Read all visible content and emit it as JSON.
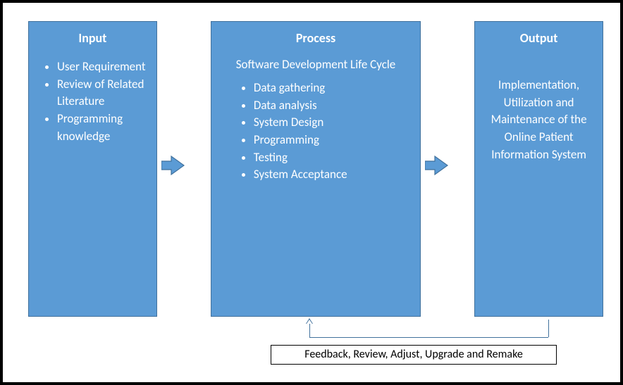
{
  "input": {
    "title": "Input",
    "items": [
      "User Requirement",
      "Review of Related Literature",
      "Programming knowledge"
    ]
  },
  "process": {
    "title": "Process",
    "subtitle": "Software Development Life Cycle",
    "items": [
      "Data gathering",
      "Data analysis",
      "System Design",
      "Programming",
      "Testing",
      "System Acceptance"
    ]
  },
  "output": {
    "title": "Output",
    "text": "Implementation, Utilization and Maintenance of the Online Patient Information System"
  },
  "feedback": "Feedback, Review, Adjust, Upgrade and Remake",
  "colors": {
    "box_fill": "#5B9BD5",
    "box_border": "#41719C",
    "arrow_fill": "#5B9BD5"
  }
}
